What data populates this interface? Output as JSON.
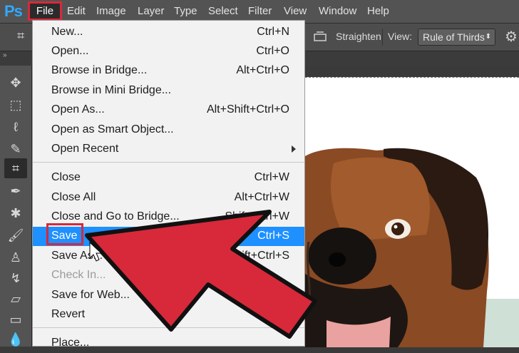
{
  "app": {
    "logo": "Ps"
  },
  "menubar": {
    "items": [
      "File",
      "Edit",
      "Image",
      "Layer",
      "Type",
      "Select",
      "Filter",
      "View",
      "Window",
      "Help"
    ]
  },
  "options_bar": {
    "straighten_label": "Straighten",
    "view_label": "View:",
    "view_value": "Rule of Thirds"
  },
  "file_menu": {
    "items": [
      {
        "label": "New...",
        "shortcut": "Ctrl+N"
      },
      {
        "label": "Open...",
        "shortcut": "Ctrl+O"
      },
      {
        "label": "Browse in Bridge...",
        "shortcut": "Alt+Ctrl+O"
      },
      {
        "label": "Browse in Mini Bridge...",
        "shortcut": ""
      },
      {
        "label": "Open As...",
        "shortcut": "Alt+Shift+Ctrl+O"
      },
      {
        "label": "Open as Smart Object...",
        "shortcut": ""
      },
      {
        "label": "Open Recent",
        "shortcut": ""
      },
      {
        "label": "Close",
        "shortcut": "Ctrl+W"
      },
      {
        "label": "Close All",
        "shortcut": "Alt+Ctrl+W"
      },
      {
        "label": "Close and Go to Bridge...",
        "shortcut": "Shift+Ctrl+W"
      },
      {
        "label": "Save",
        "shortcut": "Ctrl+S"
      },
      {
        "label": "Save As...",
        "shortcut": "Shift+Ctrl+S"
      },
      {
        "label": "Check In...",
        "shortcut": ""
      },
      {
        "label": "Save for Web...",
        "shortcut": ""
      },
      {
        "label": "Revert",
        "shortcut": ""
      },
      {
        "label": "Place...",
        "shortcut": ""
      }
    ]
  },
  "colors": {
    "highlight": "#1e90ff",
    "annotation_red": "#d7293a",
    "menubar_bg": "#535353"
  }
}
